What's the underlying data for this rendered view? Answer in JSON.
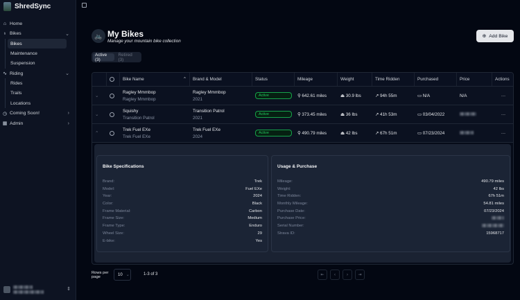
{
  "app": {
    "title": "ShredSync"
  },
  "sidebar": {
    "items": [
      {
        "label": "Home",
        "icon": "home-icon"
      },
      {
        "label": "Bikes",
        "icon": "bike-icon",
        "children": [
          "Bikes",
          "Maintenance",
          "Suspension"
        ]
      },
      {
        "label": "Riding",
        "icon": "activity-icon",
        "children": [
          "Rides",
          "Trails",
          "Locations"
        ]
      },
      {
        "label": "Coming Soon!",
        "icon": "clock-icon"
      },
      {
        "label": "Admin",
        "icon": "grid-icon"
      }
    ]
  },
  "header": {
    "title": "My Bikes",
    "subtitle": "Manage your mountain bike collection",
    "add_label": "Add Bike"
  },
  "tabs": [
    {
      "label": "Active (3)"
    },
    {
      "label": "Retired (3)"
    }
  ],
  "table": {
    "columns": [
      "Bike Name",
      "Brand & Model",
      "Status",
      "Mileage",
      "Weight",
      "Time Ridden",
      "Purchased",
      "Price",
      "Actions"
    ],
    "rows": [
      {
        "name": "Ragley Mmmbop",
        "sub": "Ragley Mmmbop",
        "brand": "Ragley Mmmbop",
        "year": "2021",
        "status": "Active",
        "mileage": "642.61 miles",
        "weight": "30.9 lbs",
        "time": "94h 55m",
        "purchased": "N/A",
        "price": "N/A"
      },
      {
        "name": "Squishy",
        "sub": "Transition Patrol",
        "brand": "Transition Patrol",
        "year": "2021",
        "status": "Active",
        "mileage": "373.45 miles",
        "weight": "36 lbs",
        "time": "41h 53m",
        "purchased": "03/04/2022",
        "price": ""
      },
      {
        "name": "Trek Fuel EXe",
        "sub": "Trek Fuel EXe",
        "brand": "Trek Fuel EXe",
        "year": "2024",
        "status": "Active",
        "mileage": "490.79 miles",
        "weight": "42 lbs",
        "time": "67h 51m",
        "purchased": "07/23/2024",
        "price": ""
      }
    ]
  },
  "details": {
    "specs": {
      "title": "Bike Specifications",
      "items": [
        [
          "Brand:",
          "Trek"
        ],
        [
          "Model:",
          "Fuel EXe"
        ],
        [
          "Year:",
          "2024"
        ],
        [
          "Color:",
          "Black"
        ],
        [
          "Frame Material:",
          "Carbon"
        ],
        [
          "Frame Size:",
          "Medium"
        ],
        [
          "Frame Type:",
          "Enduro"
        ],
        [
          "Wheel Size:",
          "29"
        ],
        [
          "E-bike:",
          "Yes"
        ]
      ]
    },
    "usage": {
      "title": "Usage & Purchase",
      "items": [
        [
          "Mileage:",
          "490.79 miles"
        ],
        [
          "Weight:",
          "42 lbs"
        ],
        [
          "Time Ridden:",
          "67h 51m"
        ],
        [
          "Monthly Mileage:",
          "54.81 miles"
        ],
        [
          "Purchase Date:",
          "07/23/2024"
        ],
        [
          "Purchase Price:",
          ""
        ],
        [
          "Serial Number:",
          ""
        ],
        [
          "Strava ID:",
          "15968717"
        ]
      ]
    }
  },
  "pagination": {
    "rows_per_page_label": "Rows per page",
    "rows_per_page": "10",
    "count": "1-3 of 3"
  },
  "colors": {
    "active_badge": "#22c55e",
    "background": "#030712",
    "sidebar": "#0d1322"
  }
}
